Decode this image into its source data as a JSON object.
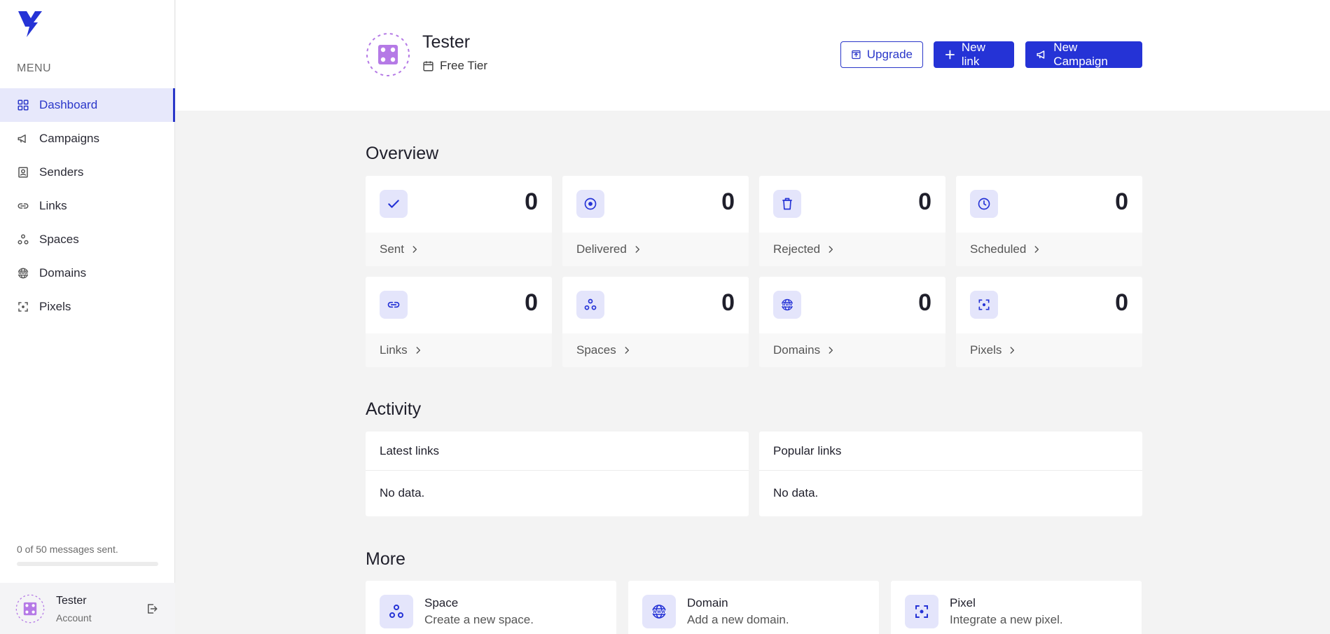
{
  "sidebar": {
    "menu_title": "MENU",
    "items": [
      {
        "label": "Dashboard",
        "icon": "grid-icon",
        "active": true
      },
      {
        "label": "Campaigns",
        "icon": "megaphone-icon"
      },
      {
        "label": "Senders",
        "icon": "contact-card-icon"
      },
      {
        "label": "Links",
        "icon": "link-icon"
      },
      {
        "label": "Spaces",
        "icon": "spaces-icon"
      },
      {
        "label": "Domains",
        "icon": "www-globe-icon"
      },
      {
        "label": "Pixels",
        "icon": "focus-frame-icon"
      }
    ],
    "usage_text": "0 of 50 messages sent.",
    "usage_fraction": 0,
    "account": {
      "name": "Tester",
      "subtitle": "Account"
    }
  },
  "header": {
    "name": "Tester",
    "tier": "Free Tier",
    "upgrade_label": "Upgrade",
    "new_link_label": "New link",
    "new_campaign_label": "New Campaign"
  },
  "overview": {
    "title": "Overview",
    "cards": [
      {
        "label": "Sent",
        "value": "0",
        "icon": "check-icon"
      },
      {
        "label": "Delivered",
        "value": "0",
        "icon": "target-icon"
      },
      {
        "label": "Rejected",
        "value": "0",
        "icon": "trash-icon"
      },
      {
        "label": "Scheduled",
        "value": "0",
        "icon": "clock-icon"
      },
      {
        "label": "Links",
        "value": "0",
        "icon": "link-icon"
      },
      {
        "label": "Spaces",
        "value": "0",
        "icon": "spaces-icon"
      },
      {
        "label": "Domains",
        "value": "0",
        "icon": "www-globe-icon"
      },
      {
        "label": "Pixels",
        "value": "0",
        "icon": "focus-frame-icon"
      }
    ]
  },
  "activity": {
    "title": "Activity",
    "latest_title": "Latest links",
    "latest_body": "No data.",
    "popular_title": "Popular links",
    "popular_body": "No data."
  },
  "more": {
    "title": "More",
    "items": [
      {
        "title": "Space",
        "desc": "Create a new space.",
        "icon": "spaces-icon"
      },
      {
        "title": "Domain",
        "desc": "Add a new domain.",
        "icon": "www-globe-icon"
      },
      {
        "title": "Pixel",
        "desc": "Integrate a new pixel.",
        "icon": "focus-frame-icon"
      }
    ]
  },
  "colors": {
    "accent": "#2533d6",
    "accent_light": "#e4e5fb",
    "avatar": "#b57ae6"
  }
}
